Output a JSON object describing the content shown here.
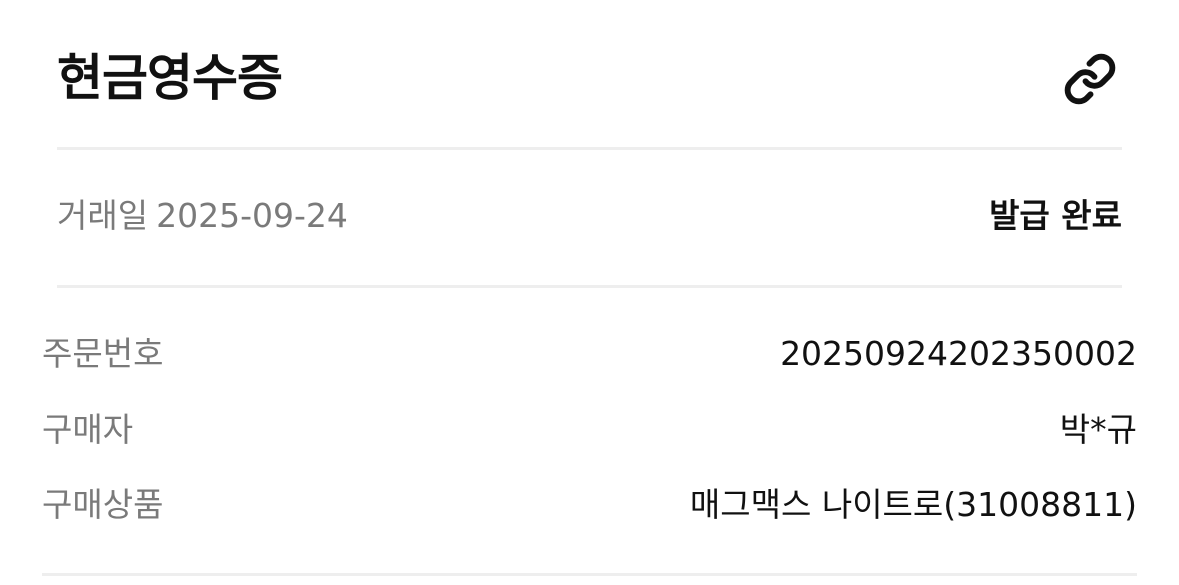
{
  "header": {
    "title": "현금영수증",
    "link_icon": "link-icon"
  },
  "status": {
    "date_label": "거래일",
    "date_value": "2025-09-24",
    "status_text": "발급 완료"
  },
  "details": {
    "order_number": {
      "label": "주문번호",
      "value": "20250924202350002"
    },
    "buyer": {
      "label": "구매자",
      "value": "박*규"
    },
    "product": {
      "label": "구매상품",
      "value": "매그맥스 나이트로(31008811)"
    }
  }
}
